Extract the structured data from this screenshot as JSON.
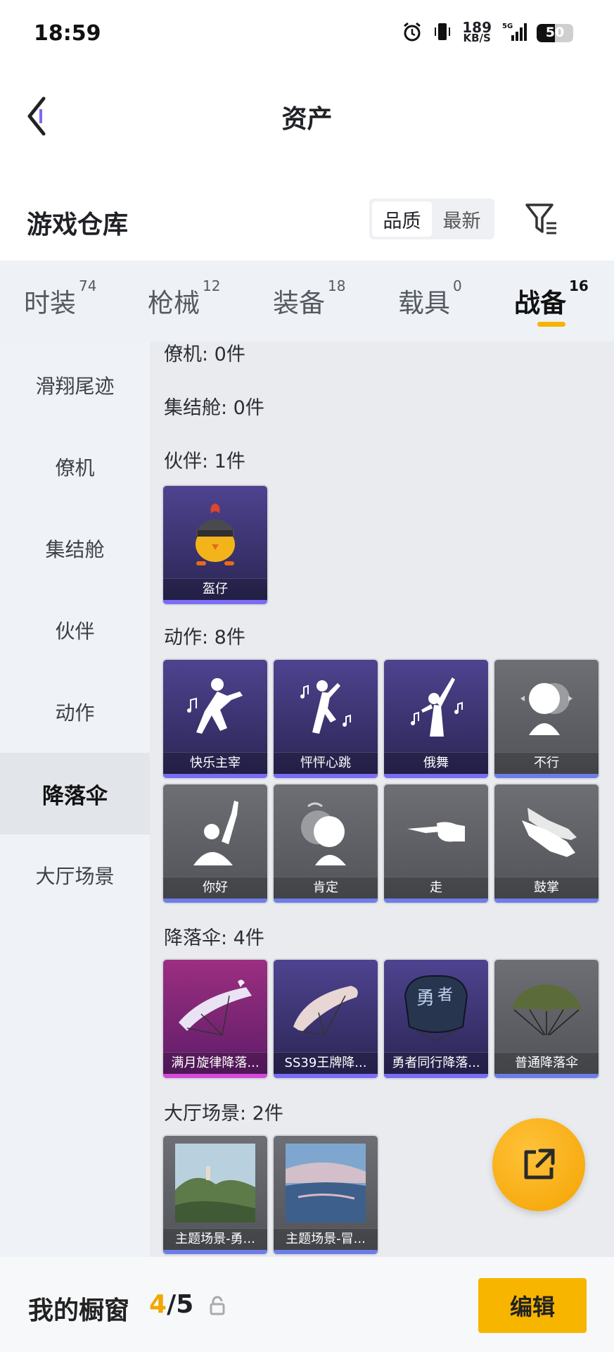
{
  "status_bar": {
    "time": "18:59",
    "net_speed": "189",
    "net_unit": "KB/S",
    "network": "5G",
    "battery": "50",
    "battery_level": 0.5
  },
  "header": {
    "back_icon": "chevron-left-icon",
    "title": "资产"
  },
  "warehouse": {
    "title": "游戏仓库",
    "sort_options": [
      "品质",
      "最新"
    ],
    "active_sort": "品质",
    "filter_icon": "filter-icon"
  },
  "tabs": [
    {
      "label": "时装",
      "count": "74"
    },
    {
      "label": "枪械",
      "count": "12"
    },
    {
      "label": "装备",
      "count": "18"
    },
    {
      "label": "载具",
      "count": "0"
    },
    {
      "label": "战备",
      "count": "16",
      "active": true
    }
  ],
  "sidebar": {
    "items": [
      {
        "label": "滑翔尾迹"
      },
      {
        "label": "僚机"
      },
      {
        "label": "集结舱"
      },
      {
        "label": "伙伴"
      },
      {
        "label": "动作"
      },
      {
        "label": "降落伞",
        "active": true
      },
      {
        "label": "大厅场景"
      }
    ]
  },
  "sections": [
    {
      "title": "僚机: 0件",
      "items": []
    },
    {
      "title": "集结舱: 0件",
      "items": []
    },
    {
      "title": "伙伴: 1件",
      "items": [
        {
          "name": "盔仔",
          "rarity": "purple",
          "icon": "chick-helmet-icon"
        }
      ]
    },
    {
      "title": "动作: 8件",
      "items": [
        {
          "name": "快乐主宰",
          "rarity": "purple",
          "icon": "dance-icon"
        },
        {
          "name": "怦怦心跳",
          "rarity": "purple",
          "icon": "dance-icon"
        },
        {
          "name": "俄舞",
          "rarity": "purple",
          "icon": "dance-icon"
        },
        {
          "name": "不行",
          "rarity": "gray",
          "icon": "head-shake-icon"
        },
        {
          "name": "你好",
          "rarity": "gray",
          "icon": "wave-icon"
        },
        {
          "name": "肯定",
          "rarity": "gray",
          "icon": "nod-icon"
        },
        {
          "name": "走",
          "rarity": "gray",
          "icon": "point-hand-icon"
        },
        {
          "name": "鼓掌",
          "rarity": "gray",
          "icon": "clap-icon"
        }
      ]
    },
    {
      "title": "降落伞: 4件",
      "items": [
        {
          "name": "满月旋律降落...",
          "rarity": "pink",
          "icon": "parachute-icon"
        },
        {
          "name": "SS39王牌降...",
          "rarity": "purple",
          "icon": "parachute-icon"
        },
        {
          "name": "勇者同行降落...",
          "rarity": "purple",
          "icon": "parachute-icon"
        },
        {
          "name": "普通降落伞",
          "rarity": "gray",
          "icon": "parachute-icon"
        }
      ]
    },
    {
      "title": "大厅场景: 2件",
      "items": [
        {
          "name": "主题场景-勇...",
          "rarity": "gray",
          "icon": "landscape-icon"
        },
        {
          "name": "主题场景-冒...",
          "rarity": "gray",
          "icon": "landscape-icon"
        }
      ]
    }
  ],
  "fab_icon": "share-icon",
  "showcase": {
    "label": "我的橱窗",
    "current": "4",
    "separator": "/",
    "total": "5",
    "lock_icon": "lock-icon",
    "edit_label": "编辑"
  },
  "colors": {
    "accent": "#f7b500",
    "rarity_purple": "#4e4390",
    "rarity_gray": "#6d6f74",
    "rarity_pink": "#9c2e80"
  }
}
